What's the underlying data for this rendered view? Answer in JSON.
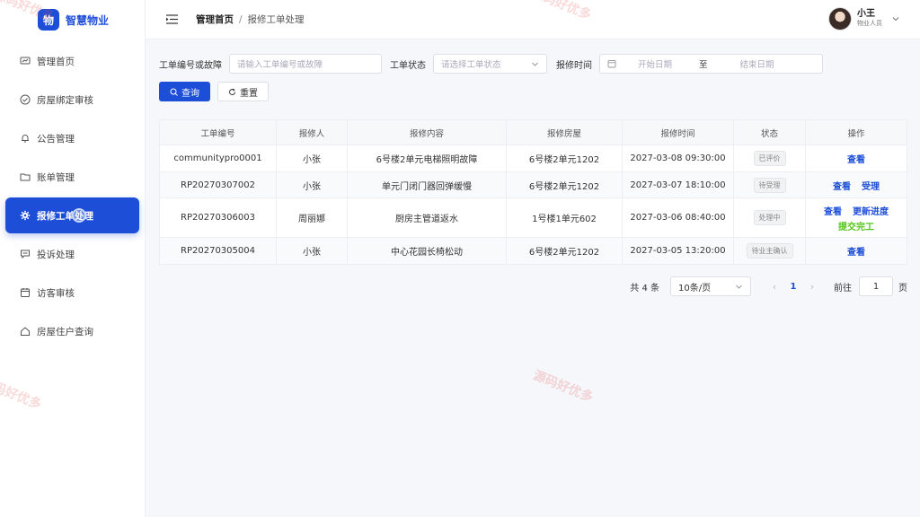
{
  "brand": {
    "logo": "物",
    "name": "智慧物业",
    "accent": "#1d4ed8"
  },
  "sidebar": {
    "items": [
      {
        "label": "管理首页",
        "icon": "dashboard-icon"
      },
      {
        "label": "房屋绑定审核",
        "icon": "check-circle-icon"
      },
      {
        "label": "公告管理",
        "icon": "bell-icon"
      },
      {
        "label": "账单管理",
        "icon": "folder-icon"
      },
      {
        "label": "报修工单处理",
        "icon": "gear-icon",
        "active": true
      },
      {
        "label": "投诉处理",
        "icon": "chat-icon"
      },
      {
        "label": "访客审核",
        "icon": "calendar-icon"
      },
      {
        "label": "房屋住户查询",
        "icon": "home-icon"
      }
    ]
  },
  "header": {
    "breadcrumb_home": "管理首页",
    "breadcrumb_sep": "/",
    "breadcrumb_current": "报修工单处理",
    "user_name": "小王",
    "user_role": "物业人员"
  },
  "filter": {
    "order_label": "工单编号或故障",
    "order_placeholder": "请输入工单编号或故障",
    "status_label": "工单状态",
    "status_placeholder": "请选择工单状态",
    "time_label": "报修时间",
    "start_placeholder": "开始日期",
    "range_sep": "至",
    "end_placeholder": "结束日期",
    "search_btn": "查询",
    "reset_btn": "重置"
  },
  "table": {
    "columns": [
      "工单编号",
      "报修人",
      "报修内容",
      "报修房屋",
      "报修时间",
      "状态",
      "操作"
    ],
    "rows": [
      {
        "id": "communitypro0001",
        "reporter": "小张",
        "content": "6号楼2单元电梯照明故障",
        "house": "6号楼2单元1202",
        "time": "2027-03-08 09:30:00",
        "status": "已评价",
        "ops": [
          "查看"
        ]
      },
      {
        "id": "RP20270307002",
        "reporter": "小张",
        "content": "单元门闭门器回弹缓慢",
        "house": "6号楼2单元1202",
        "time": "2027-03-07 18:10:00",
        "status": "待受理",
        "ops": [
          "查看",
          "受理"
        ]
      },
      {
        "id": "RP20270306003",
        "reporter": "周丽娜",
        "content": "厨房主管道返水",
        "house": "1号楼1单元602",
        "time": "2027-03-06 08:40:00",
        "status": "处理中",
        "ops": [
          "查看",
          "更新进度",
          "提交完工"
        ]
      },
      {
        "id": "RP20270305004",
        "reporter": "小张",
        "content": "中心花园长椅松动",
        "house": "6号楼2单元1202",
        "time": "2027-03-05 13:20:00",
        "status": "待业主确认",
        "ops": [
          "查看"
        ]
      }
    ]
  },
  "pagination": {
    "total": "共 4 条",
    "page_size": "10条/页",
    "prev": "‹",
    "current": "1",
    "next": "›",
    "goto_label": "前往",
    "goto_value": "1",
    "page_unit": "页"
  },
  "watermark": "源码好优多"
}
